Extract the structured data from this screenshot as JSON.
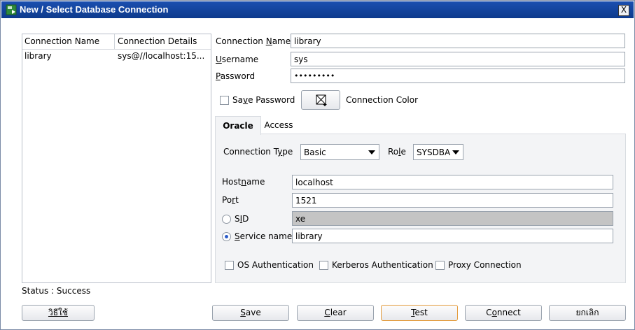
{
  "window": {
    "title": "New / Select Database Connection",
    "close_label": "X"
  },
  "connections": {
    "headers": [
      "Connection Name",
      "Connection Details"
    ],
    "rows": [
      {
        "name": "library",
        "details": "sys@//localhost:15..."
      }
    ]
  },
  "form": {
    "connection_name": {
      "label": "Connection Name",
      "value": "library"
    },
    "username": {
      "label": "Username",
      "value": "sys"
    },
    "password": {
      "label": "Password",
      "value": "•••••••••"
    },
    "save_password": {
      "label": "Save Password",
      "checked": false
    },
    "connection_color": {
      "label": "Connection Color"
    }
  },
  "tabs": [
    {
      "label": "Oracle",
      "active": true
    },
    {
      "label": "Access",
      "active": false
    }
  ],
  "oracle": {
    "connection_type": {
      "label": "Connection Type",
      "value": "Basic"
    },
    "role": {
      "label": "Role",
      "value": "SYSDBA"
    },
    "hostname": {
      "label": "Hostname",
      "value": "localhost"
    },
    "port": {
      "label": "Port",
      "value": "1521"
    },
    "sid": {
      "label": "SID",
      "value": "xe",
      "selected": false
    },
    "service_name": {
      "label": "Service name",
      "value": "library",
      "selected": true
    },
    "os_auth": {
      "label": "OS Authentication",
      "checked": false
    },
    "kerberos_auth": {
      "label": "Kerberos Authentication",
      "checked": false
    },
    "proxy_conn": {
      "label": "Proxy Connection",
      "checked": false
    }
  },
  "status": "Status : Success",
  "buttons": {
    "help": "วิธีใช้",
    "save": "Save",
    "clear": "Clear",
    "test": "Test",
    "connect": "Connect",
    "cancel": "ยกเลิก"
  }
}
